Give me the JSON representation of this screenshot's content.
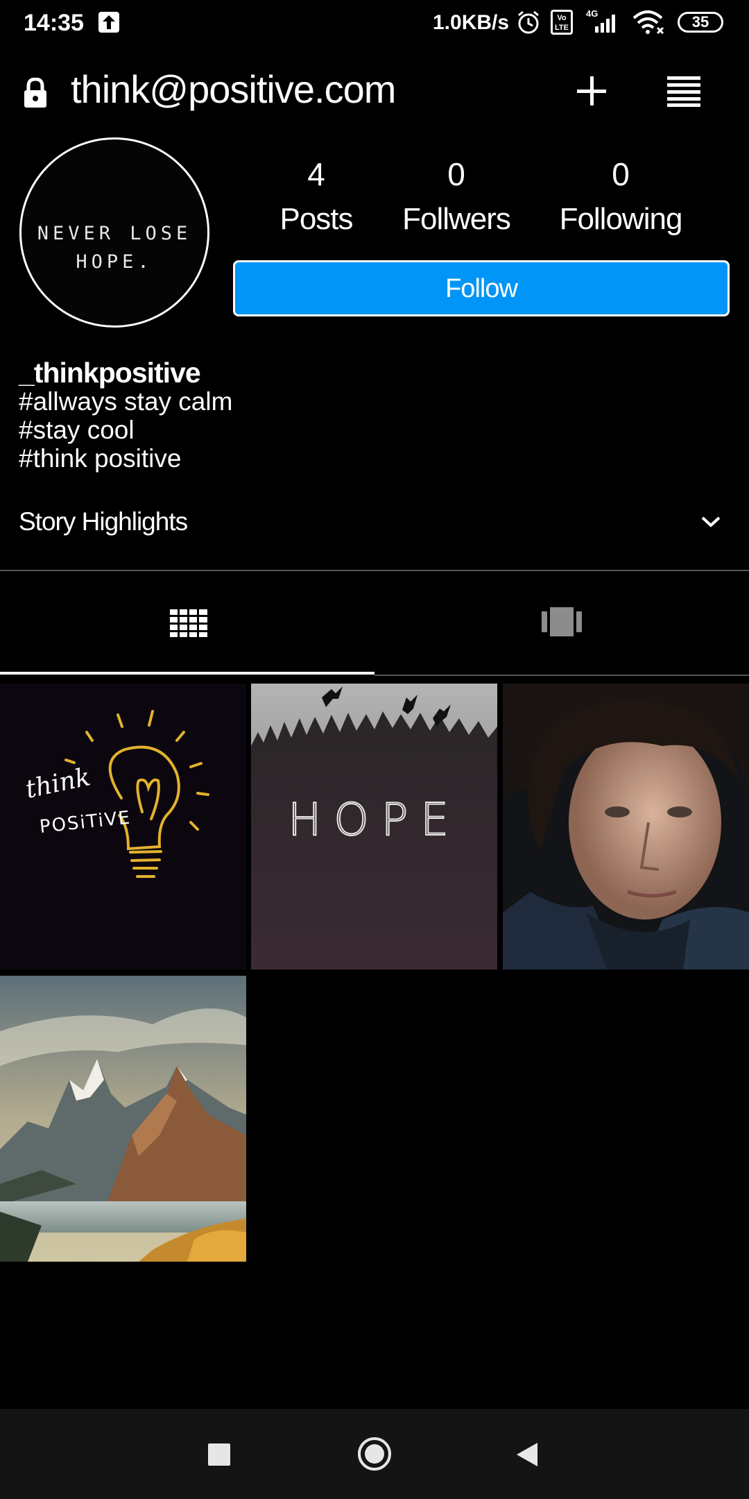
{
  "status_bar": {
    "time": "14:35",
    "network_speed": "1.0KB/s",
    "network_type": "4G",
    "volte": "Vo LTE",
    "battery": "35"
  },
  "header": {
    "account": "think@positive.com"
  },
  "profile": {
    "avatar_text_line1": "NEVER LOSE",
    "avatar_text_line2": "HOPE.",
    "stats": {
      "posts_count": "4",
      "posts_label": "Posts",
      "followers_count": "0",
      "followers_label": "Follwers",
      "following_count": "0",
      "following_label": "Following"
    },
    "follow_label": "Follow",
    "username": "_thinkpositive",
    "bio": [
      "#allways stay calm",
      "#stay cool",
      "#think positive"
    ]
  },
  "highlights": {
    "label": "Story Highlights"
  },
  "tabs": [
    "grid",
    "feed"
  ],
  "posts": [
    {
      "caption_line1": "think",
      "caption_line2": "POSiTiVE"
    },
    {
      "caption": "HOPE"
    },
    {},
    {}
  ],
  "colors": {
    "accent": "#0095f6",
    "background": "#000000",
    "navbar": "#141414"
  },
  "icons": {
    "status_upload": "upload-arrow-icon",
    "alarm": "alarm-icon",
    "signal": "signal-icon",
    "wifi": "wifi-icon",
    "lock": "lock-icon",
    "add": "plus-icon",
    "menu": "menu-icon",
    "chevron": "chevron-down-icon",
    "grid": "grid-icon",
    "feed": "carousel-icon",
    "nav_recents": "square-icon",
    "nav_home": "circle-icon",
    "nav_back": "triangle-back-icon"
  }
}
